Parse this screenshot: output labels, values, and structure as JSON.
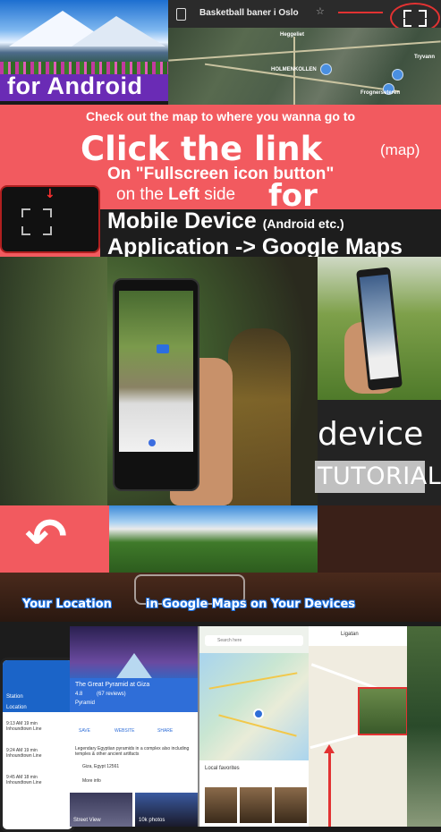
{
  "top_banner": {
    "platform_label": "for Android"
  },
  "map_header": {
    "title": "Basketball baner i Oslo"
  },
  "map_labels": [
    "Heggeliet",
    "HOLMENKOLLEN",
    "Tryvann",
    "Frognerseteren"
  ],
  "promo": {
    "check_line": "Check out the map to where you wanna go to",
    "click_line": "Click the link",
    "click_paren": "(map)",
    "on_fs_line": "On \"Fullscreen icon button\"",
    "on_the": "on the ",
    "left_word": "Left",
    "side_word": " side",
    "for_word": "for",
    "mobile_line": "Mobile Device",
    "mobile_sub": "(Android etc.)",
    "app_line": "Application -> Google Maps"
  },
  "device_caption": {
    "word1": "device",
    "word2": "TUTORIAL"
  },
  "location_caption": {
    "left": "Your Location",
    "right": "in Google Maps on Your Devices"
  },
  "phone1": {
    "station": "Station",
    "button": "Location",
    "rows": [
      {
        "time": "9:13 AM",
        "mins": "19 min",
        "name": "Inhoundtown Line"
      },
      {
        "time": "9:24 AM",
        "mins": "19 min",
        "name": "Inhoundtown Line"
      },
      {
        "time": "9:45 AM",
        "mins": "18 min",
        "name": "Inhoundtown Line"
      }
    ]
  },
  "phone2": {
    "place": "The Great Pyramid at Giza",
    "rating": "4.8",
    "reviews": "(67 reviews)",
    "type": "Pyramid",
    "actions": [
      "SAVE",
      "WEBSITE",
      "SHARE"
    ],
    "desc": "Legendary Egyptian pyramids in a complex also including temples & other ancient artifacts",
    "addr": "Giza, Egypt 12561",
    "more": "More info",
    "photos_left": "Street View",
    "photos_right": "10k photos"
  },
  "phone3": {
    "search": "Search here",
    "header": "Local favorites"
  },
  "phone4": {
    "city": "Ligatan"
  },
  "colors": {
    "coral": "#f25a5f",
    "android_purple": "#6a2bb5",
    "map_bar": "#2b2b2b",
    "accent_red": "#e23232"
  }
}
